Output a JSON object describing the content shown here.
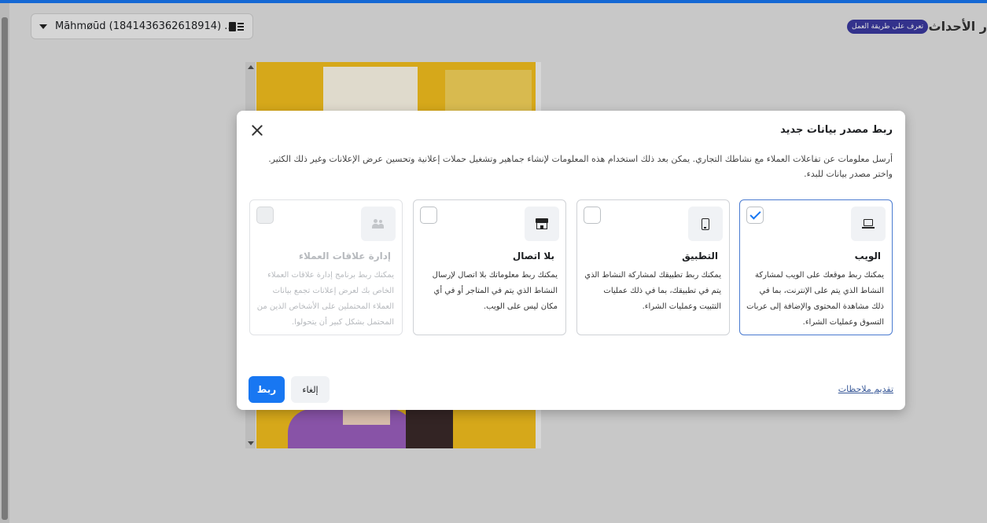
{
  "header": {
    "page_title": "ر الأحداث",
    "learn_pill": "تعرف على طريقة العمل",
    "account_select": "Māhmøūd (1841436362618914) ...",
    "account_icon": "account-switch-icon"
  },
  "modal": {
    "title": "ربط مصدر بيانات جديد",
    "description": "أرسل معلومات عن تفاعلات العملاء مع نشاطك التجاري. يمكن بعد ذلك استخدام هذه المعلومات لإنشاء جماهير وتشغيل حملات إعلانية وتحسين عرض الإعلانات وغير ذلك الكثير. واختر مصدر بيانات للبدء.",
    "options": [
      {
        "title": "الويب",
        "description": "يمكنك ربط موقعك على الويب لمشاركة النشاط الذي يتم على الإنترنت، بما في ذلك مشاهدة المحتوى والإضافة إلى عربات التسوق وعمليات الشراء.",
        "icon": "laptop-icon",
        "selected": true,
        "disabled": false
      },
      {
        "title": "التطبيق",
        "description": "يمكنك ربط تطبيقك لمشاركة النشاط الذي يتم في تطبيقك، بما في ذلك عمليات التثبيت وعمليات الشراء.",
        "icon": "phone-icon",
        "selected": false,
        "disabled": false
      },
      {
        "title": "بلا اتصال",
        "description": "يمكنك ربط معلوماتك بلا اتصال لإرسال النشاط الذي يتم في المتاجر أو في أي مكان ليس على الويب.",
        "icon": "store-icon",
        "selected": false,
        "disabled": false
      },
      {
        "title": "إدارة علاقات العملاء",
        "description": "يمكنك ربط برنامج إدارة علاقات العملاء الخاص بك لعرض إعلانات تجمع بيانات العملاء المحتملين على الأشخاص الذين من المحتمل بشكل كبير أن يتحولوا.",
        "icon": "people-icon",
        "selected": false,
        "disabled": true
      }
    ],
    "feedback_link": "تقديم ملاحظات",
    "cancel_label": "إلغاء",
    "connect_label": "ربط"
  },
  "colors": {
    "accent": "#1877f2",
    "selected_border": "#4a7bd0",
    "pill": "#3b3aa0"
  }
}
